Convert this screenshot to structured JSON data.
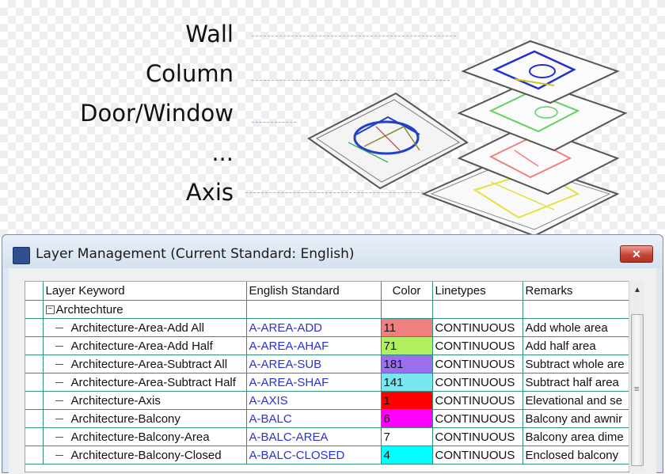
{
  "illustration": {
    "labels": [
      "Wall",
      "Column",
      "Door/Window",
      "...",
      "Axis"
    ]
  },
  "window": {
    "title": "Layer Management (Current Standard: English)",
    "close_glyph": "✕",
    "icon": "app-layer-icon"
  },
  "table": {
    "columns": [
      "Layer Keyword",
      "English Standard",
      "Color",
      "Linetypes",
      "Remarks"
    ],
    "group": {
      "expander": "−",
      "label": "Archtechture"
    },
    "rows": [
      {
        "keyword": "Architecture-Area-Add All",
        "english": "A-AREA-ADD",
        "color": "11",
        "color_hex": "#f08080",
        "linetype": "CONTINUOUS",
        "remarks": "Add whole area"
      },
      {
        "keyword": "Architecture-Area-Add Half",
        "english": "A-AREA-AHAF",
        "color": "71",
        "color_hex": "#b0f060",
        "linetype": "CONTINUOUS",
        "remarks": "Add half area"
      },
      {
        "keyword": "Architecture-Area-Subtract All",
        "english": "A-AREA-SUB",
        "color": "181",
        "color_hex": "#9b70f0",
        "linetype": "CONTINUOUS",
        "remarks": "Subtract whole are"
      },
      {
        "keyword": "Architecture-Area-Subtract Half",
        "english": "A-AREA-SHAF",
        "color": "141",
        "color_hex": "#78e6f0",
        "linetype": "CONTINUOUS",
        "remarks": "Subtract half area"
      },
      {
        "keyword": "Architecture-Axis",
        "english": "A-AXIS",
        "color": "1",
        "color_hex": "#ff0000",
        "linetype": "CONTINUOUS",
        "remarks": "Elevational and se"
      },
      {
        "keyword": "Architecture-Balcony",
        "english": "A-BALC",
        "color": "6",
        "color_hex": "#ff00ff",
        "linetype": "CONTINUOUS",
        "remarks": "Balcony and awnir"
      },
      {
        "keyword": "Architecture-Balcony-Area",
        "english": "A-BALC-AREA",
        "color": "7",
        "color_hex": "#ffffff",
        "linetype": "CONTINUOUS",
        "remarks": "Balcony area dime"
      },
      {
        "keyword": "Architecture-Balcony-Closed",
        "english": "A-BALC-CLOSED",
        "color": "4",
        "color_hex": "#00ffff",
        "linetype": "CONTINUOUS",
        "remarks": "Enclosed balcony"
      }
    ]
  },
  "scrollbar": {
    "up_glyph": "▲",
    "grip_glyph": "≡"
  }
}
